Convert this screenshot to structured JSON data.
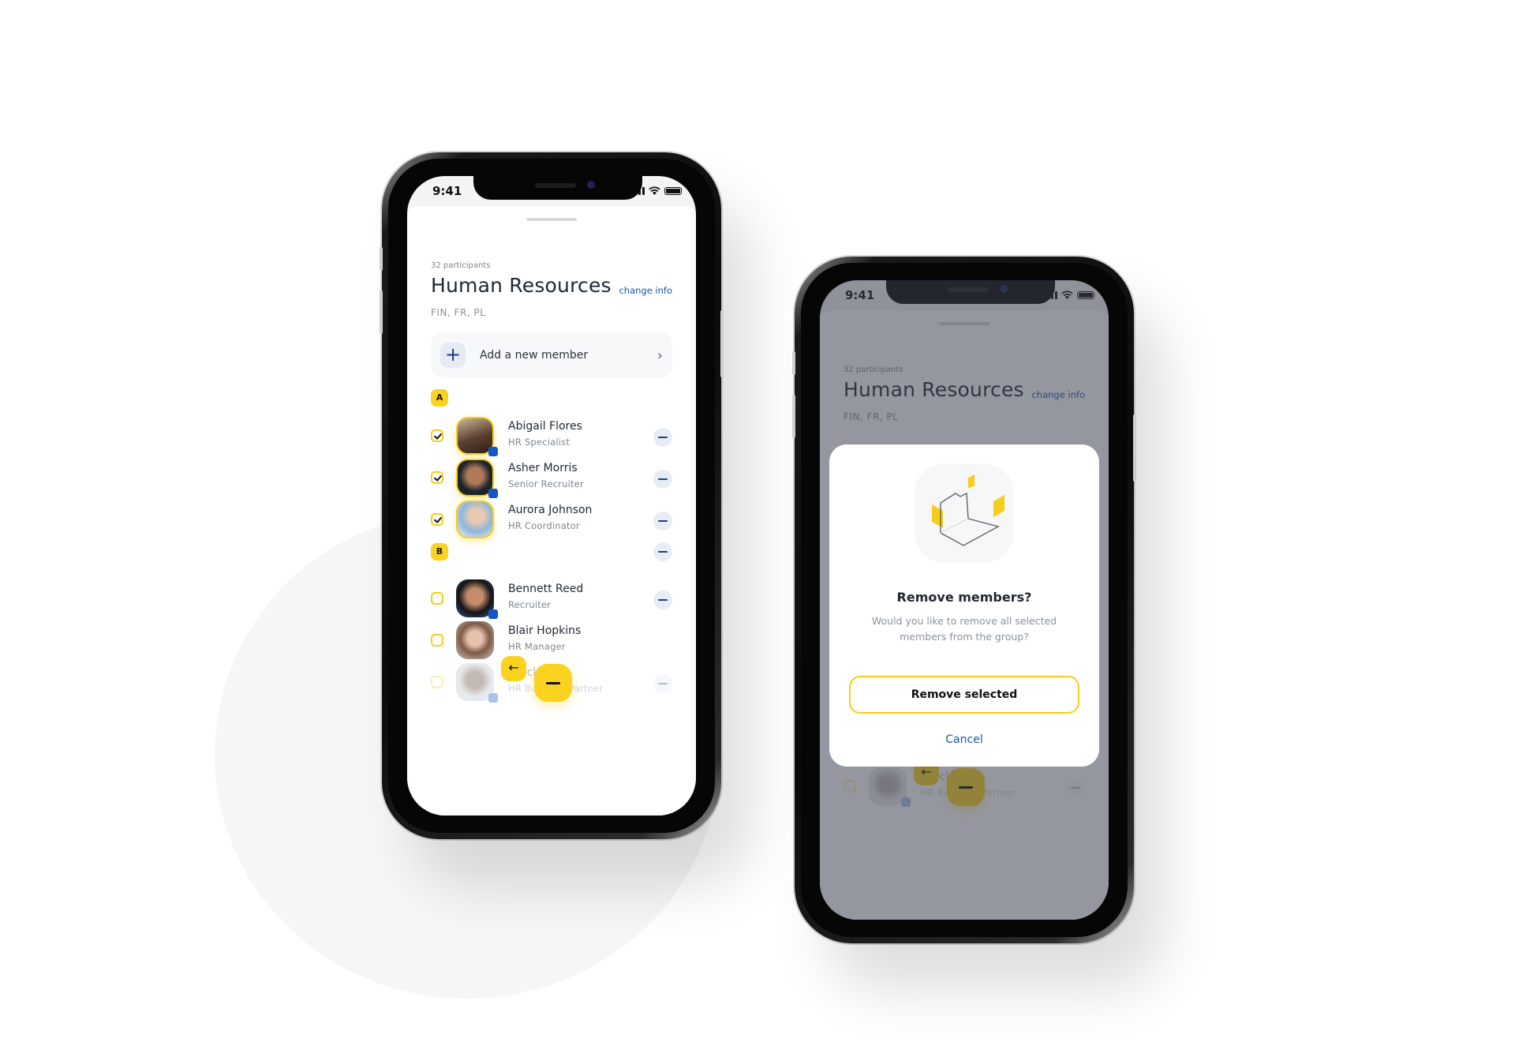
{
  "colors": {
    "accent": "#fad21f",
    "link": "#1a56b0",
    "primary_dark": "#1c3f8a"
  },
  "status_bar": {
    "time": "9:41",
    "icons": [
      "signal-icon",
      "wifi-icon",
      "battery-icon"
    ]
  },
  "group": {
    "participants": "32 participants",
    "title": "Human Resources",
    "change_info": "change info",
    "languages": "FIN, FR, PL",
    "add_member": "Add a new member"
  },
  "sections": [
    {
      "letter": "A",
      "members": [
        {
          "name": "Abigail Flores",
          "role": "HR Specialist",
          "checked": true,
          "online": true
        },
        {
          "name": "Asher Morris",
          "role": "Senior Recruiter",
          "checked": true,
          "online": true
        },
        {
          "name": "Aurora Johnson",
          "role": "HR Coordinator",
          "checked": true,
          "online": false
        }
      ]
    },
    {
      "letter": "B",
      "members": [
        {
          "name": "Bennett Reed",
          "role": "Recruiter",
          "checked": false,
          "online": true
        },
        {
          "name": "Blair Hopkins",
          "role": "HR Manager",
          "checked": false,
          "online": false
        },
        {
          "name": "Brock ...ar",
          "role": "HR Business Partner",
          "checked": false,
          "online": true
        }
      ]
    }
  ],
  "fab": {
    "back_icon": "←"
  },
  "modal": {
    "title": "Remove members?",
    "description": "Would you like to remove all selected members from the group?",
    "confirm": "Remove selected",
    "cancel": "Cancel"
  }
}
